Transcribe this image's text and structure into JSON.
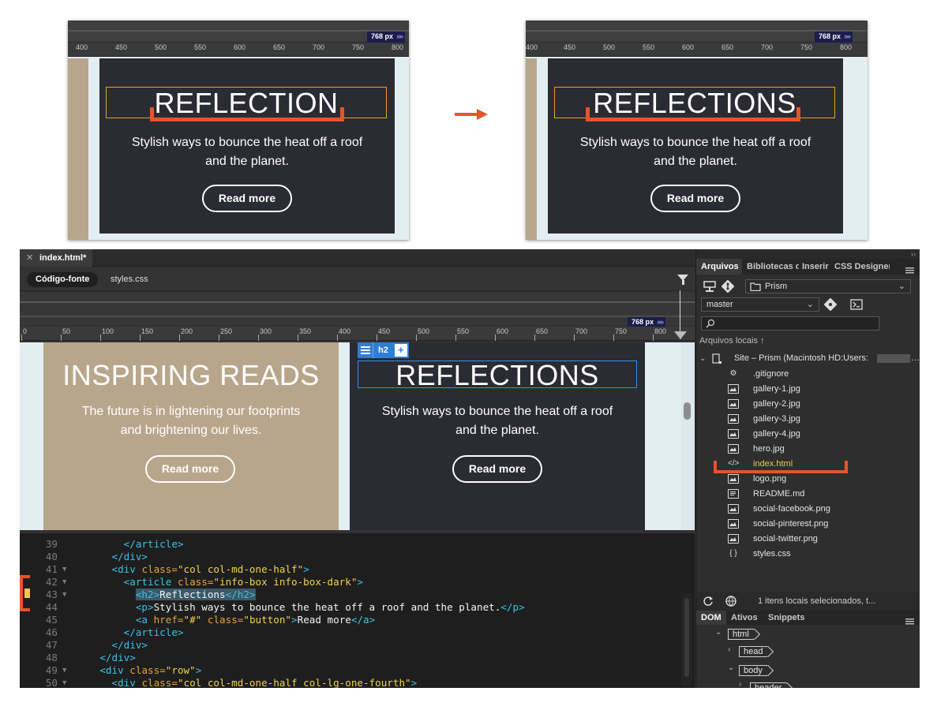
{
  "thumbnail_before": {
    "ruler_ticks": [
      "400",
      "450",
      "500",
      "550",
      "600",
      "650",
      "700",
      "750",
      "800"
    ],
    "px_value": "768",
    "px_unit": "px",
    "heading": "REFLECTION",
    "subtext": "Stylish ways to bounce the heat off a roof and the planet.",
    "button": "Read more"
  },
  "thumbnail_after": {
    "ruler_ticks": [
      "400",
      "450",
      "500",
      "550",
      "600",
      "650",
      "700",
      "750",
      "800"
    ],
    "px_value": "768",
    "px_unit": "px",
    "heading": "REFLECTIONS",
    "subtext": "Stylish ways to bounce the heat off a roof and the planet.",
    "button": "Read more"
  },
  "arrow_color": "#e3562b",
  "editor": {
    "doc_tab": "index.html*",
    "source_pill": "Código-fonte",
    "related_file": "styles.css",
    "ruler_ticks": [
      "0",
      "50",
      "100",
      "150",
      "200",
      "250",
      "300",
      "350",
      "400",
      "450",
      "500",
      "550",
      "600",
      "650",
      "700",
      "750",
      "800"
    ],
    "px_value": "768",
    "px_unit": "px",
    "hud_tag": "h2",
    "hud_plus": "+",
    "live_left": {
      "heading": "INSPIRING READS",
      "subtext": "The future is in lightening our footprints and brightening our lives.",
      "button": "Read more"
    },
    "live_right": {
      "heading": "REFLECTIONS",
      "subtext": "Stylish ways to bounce the heat off a roof and the planet.",
      "button": "Read more"
    },
    "code_lines": [
      {
        "num": "39",
        "fold": "",
        "html": "        <span class='tg'>&lt;/article&gt;</span>"
      },
      {
        "num": "40",
        "fold": "",
        "html": "      <span class='tg'>&lt;/div&gt;</span>"
      },
      {
        "num": "41",
        "fold": "▼",
        "html": "      <span class='tg'>&lt;div</span> <span class='at'>class=</span><span class='av'>\"col col-md-one-half\"</span><span class='tg'>&gt;</span>"
      },
      {
        "num": "42",
        "fold": "▼",
        "html": "        <span class='tg'>&lt;article</span> <span class='at'>class=</span><span class='av'>\"info-box info-box-dark\"</span><span class='tg'>&gt;</span>"
      },
      {
        "num": "43",
        "fold": "▼",
        "html": "          <span class='hl'><span class='tg'>&lt;h2&gt;</span><span class='tx'>Reflections</span><span class='tg'>&lt;/h2&gt;</span></span>"
      },
      {
        "num": "44",
        "fold": "",
        "html": "          <span class='tg'>&lt;p&gt;</span><span class='tx'>Stylish ways to bounce the heat off a roof and the planet.</span><span class='tg'>&lt;/p&gt;</span>"
      },
      {
        "num": "45",
        "fold": "",
        "html": "          <span class='tg'>&lt;a</span> <span class='at'>href=</span><span class='av'>\"#\"</span> <span class='at'>class=</span><span class='av'>\"button\"</span><span class='tg'>&gt;</span><span class='tx'>Read more</span><span class='tg'>&lt;/a&gt;</span>"
      },
      {
        "num": "46",
        "fold": "",
        "html": "        <span class='tg'>&lt;/article&gt;</span>"
      },
      {
        "num": "47",
        "fold": "",
        "html": "      <span class='tg'>&lt;/div&gt;</span>"
      },
      {
        "num": "48",
        "fold": "",
        "html": "    <span class='tg'>&lt;/div&gt;</span>"
      },
      {
        "num": "49",
        "fold": "▼",
        "html": "    <span class='tg'>&lt;div</span> <span class='at'>class=</span><span class='av'>\"row\"</span><span class='tg'>&gt;</span>"
      },
      {
        "num": "50",
        "fold": "▼",
        "html": "      <span class='tg'>&lt;div</span> <span class='at'>class=</span><span class='av'>\"col col-md-one-half col-lg-one-fourth\"</span><span class='tg'>&gt;</span>"
      }
    ]
  },
  "panel": {
    "tabs": [
      "Arquivos",
      "Bibliotecas d",
      "Inserir",
      "CSS Designer"
    ],
    "site_select": "Prism",
    "branch_select": "master",
    "local_files_title": "Arquivos locais",
    "site_root": "Site – Prism (Macintosh HD:Users:",
    "site_root_tail": "…",
    "files": [
      {
        "name": ".gitignore",
        "icon": "gear-file-icon"
      },
      {
        "name": "gallery-1.jpg",
        "icon": "image-icon"
      },
      {
        "name": "gallery-2.jpg",
        "icon": "image-icon"
      },
      {
        "name": "gallery-3.jpg",
        "icon": "image-icon"
      },
      {
        "name": "gallery-4.jpg",
        "icon": "image-icon"
      },
      {
        "name": "hero.jpg",
        "icon": "image-icon"
      },
      {
        "name": "index.html",
        "icon": "code-icon"
      },
      {
        "name": "logo.png",
        "icon": "image-icon"
      },
      {
        "name": "README.md",
        "icon": "document-icon"
      },
      {
        "name": "social-facebook.png",
        "icon": "image-icon"
      },
      {
        "name": "social-pinterest.png",
        "icon": "image-icon"
      },
      {
        "name": "social-twitter.png",
        "icon": "image-icon"
      },
      {
        "name": "styles.css",
        "icon": "braces-icon"
      }
    ],
    "status": "1 itens locais selecionados, t...",
    "bottom_tabs": [
      "DOM",
      "Ativos",
      "Snippets"
    ],
    "dom_nodes": [
      "html",
      "head",
      "body",
      "header"
    ]
  }
}
